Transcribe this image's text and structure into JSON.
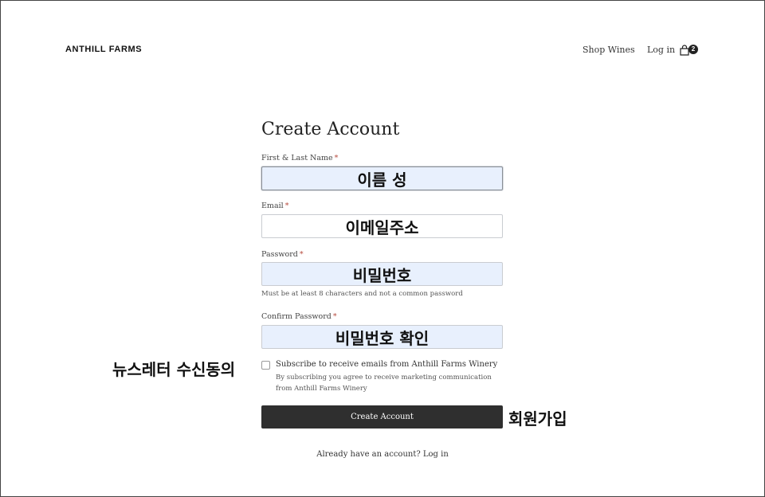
{
  "header": {
    "brand": "ANTHILL FARMS",
    "nav": {
      "shop_label": "Shop Wines",
      "login_label": "Log in"
    },
    "cart": {
      "icon": "shopping-bag-icon",
      "count": "2"
    }
  },
  "form": {
    "title": "Create Account",
    "required_mark": "*",
    "name": {
      "label": "First & Last Name",
      "value": "이름 성"
    },
    "email": {
      "label": "Email",
      "value": "이메일주소"
    },
    "password": {
      "label": "Password",
      "value": "비밀번호",
      "hint": "Must be at least 8 characters and not a common password"
    },
    "confirm_password": {
      "label": "Confirm Password",
      "value": "비밀번호 확인"
    },
    "subscribe": {
      "checked": false,
      "label": "Subscribe to receive emails from Anthill Farms Winery",
      "description": "By subscribing you agree to receive marketing communication from Anthill Farms Winery"
    },
    "submit_label": "Create Account",
    "already_text": "Already have an account? Log in"
  },
  "annotations": {
    "newsletter": "뉴스레터 수신동의",
    "signup": "회원가입"
  },
  "colors": {
    "button_bg": "#2f2f2f",
    "autofill_bg": "#e8f0fd",
    "required": "#b5473a"
  }
}
